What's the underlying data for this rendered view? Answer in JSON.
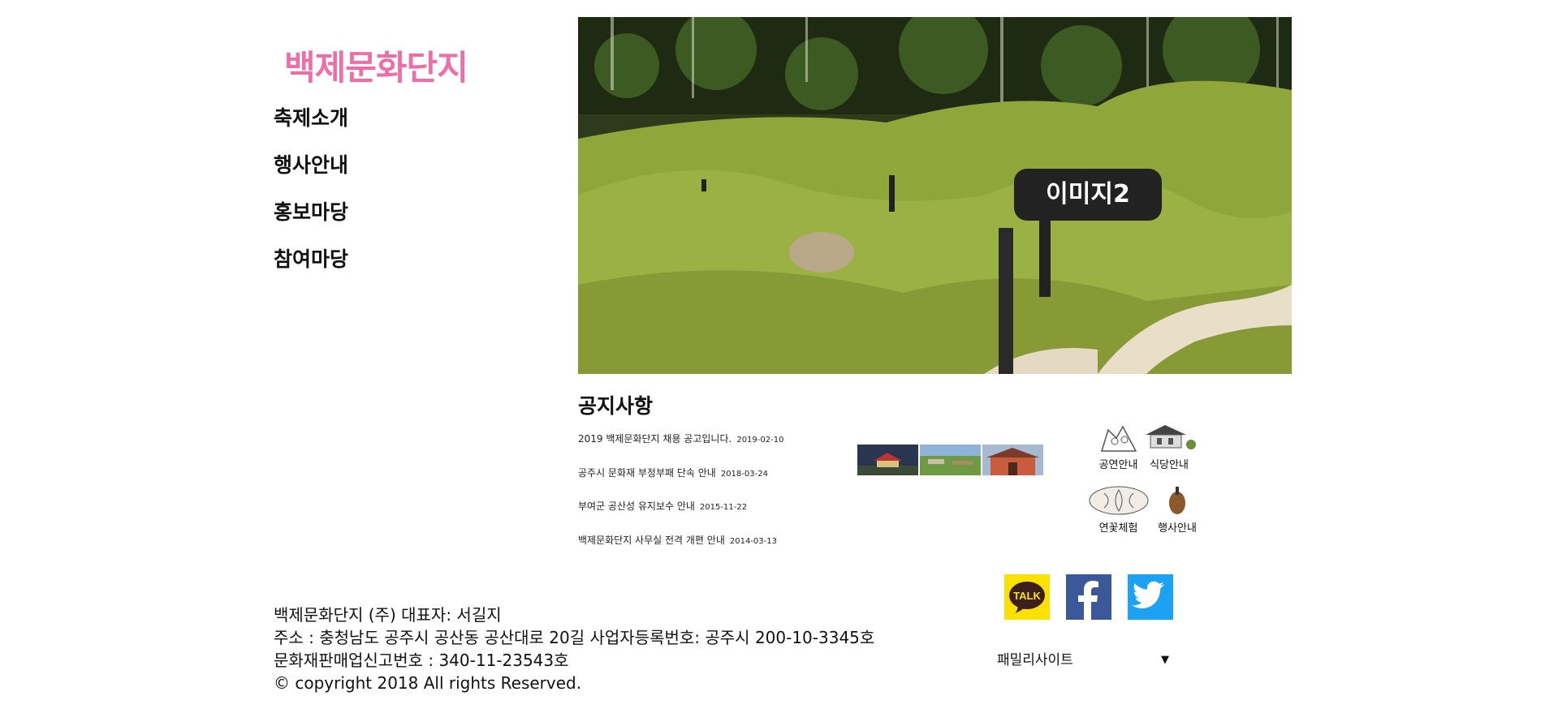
{
  "header": {
    "logo": "백제문화단지"
  },
  "nav": {
    "items": [
      {
        "label": "축제소개"
      },
      {
        "label": "행사안내"
      },
      {
        "label": "홍보마당"
      },
      {
        "label": "참여마당"
      }
    ]
  },
  "hero": {
    "label": "이미지2"
  },
  "notice": {
    "title": "공지사항",
    "items": [
      {
        "text": "2019 백제문화단지 채용 공고입니다.",
        "date": "2019-02-10"
      },
      {
        "text": "공주시 문화재 부정부패 단속 안내",
        "date": "2018-03-24"
      },
      {
        "text": "부여군 공산성 유지보수 안내",
        "date": "2015-11-22"
      },
      {
        "text": "백제문화단지 사무실 전격 개편 안내",
        "date": "2014-03-13"
      }
    ]
  },
  "quick_links": [
    {
      "label": "공연안내"
    },
    {
      "label": "식당안내"
    },
    {
      "label": "연꽃체험"
    },
    {
      "label": "행사안내"
    }
  ],
  "social": {
    "kakao_label": "TALK"
  },
  "footer": {
    "line1": "백제문화단지 (주) 대표자: 서길지",
    "line2": "주소 : 충청남도 공주시 공산동 공산대로 20길 사업자등록번호: 공주시 200-10-3345호",
    "line3": "문화재판매업신고번호 : 340-11-23543호",
    "line4": "© copyright 2018 All rights Reserved."
  },
  "family_site": {
    "selected": "패밀리사이트",
    "arrow": "▼"
  }
}
